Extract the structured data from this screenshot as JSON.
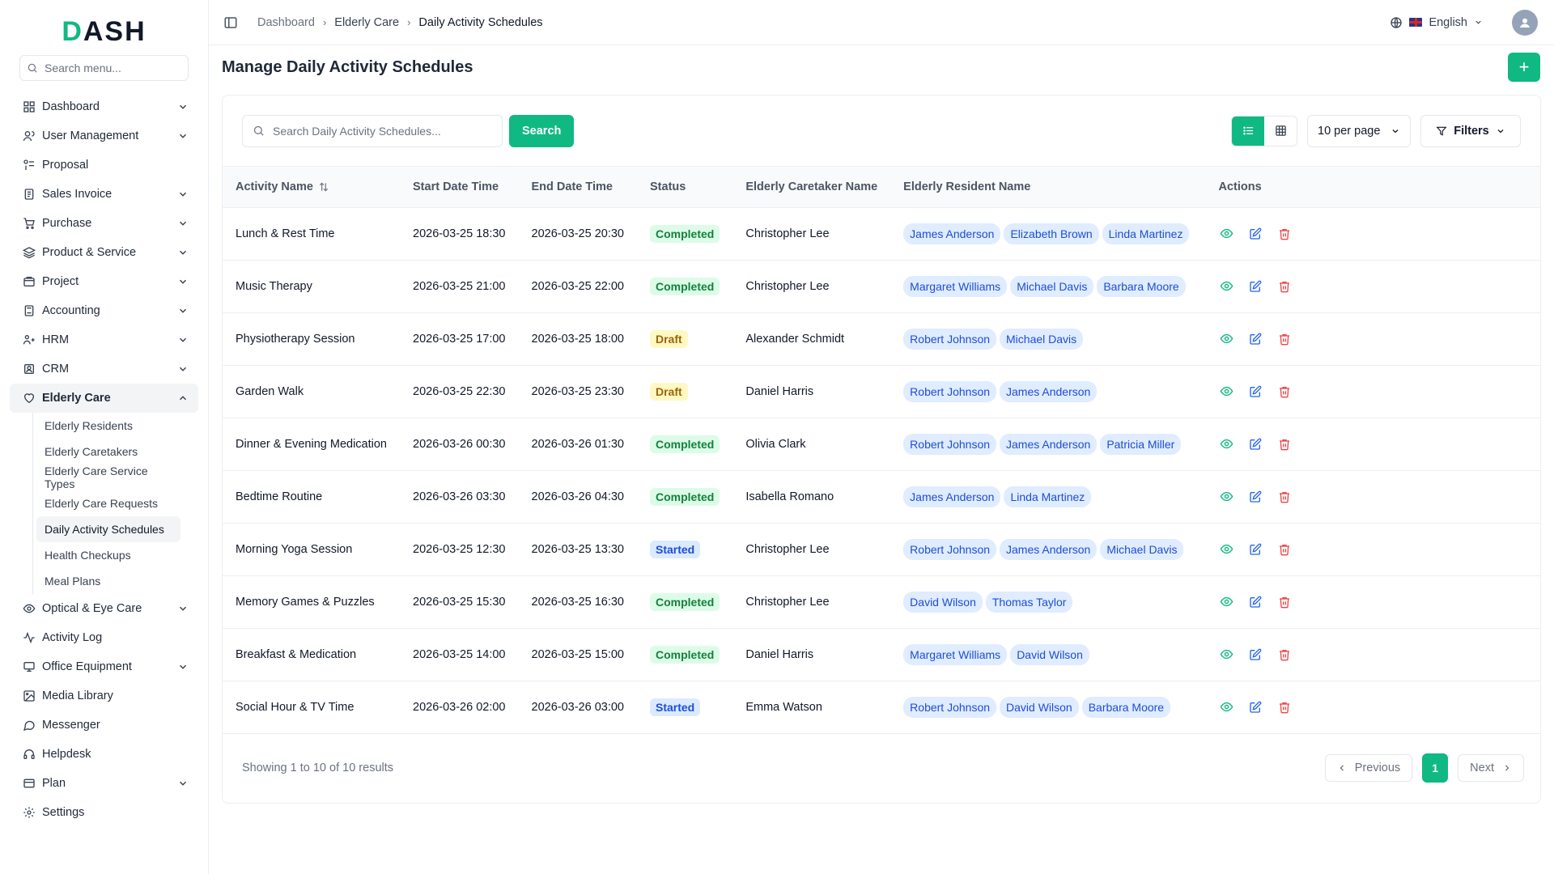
{
  "brand": {
    "logo_prefix": "D",
    "logo_rest": "ASH",
    "accent_color": "#10b981"
  },
  "sidebar": {
    "search_placeholder": "Search menu...",
    "items": [
      {
        "label": "Dashboard",
        "icon": "dashboard-icon",
        "chevron": "down"
      },
      {
        "label": "User Management",
        "icon": "users-icon",
        "chevron": "down"
      },
      {
        "label": "Proposal",
        "icon": "proposal-icon",
        "chevron": ""
      },
      {
        "label": "Sales Invoice",
        "icon": "invoice-icon",
        "chevron": "down"
      },
      {
        "label": "Purchase",
        "icon": "cart-icon",
        "chevron": "down"
      },
      {
        "label": "Product & Service",
        "icon": "layers-icon",
        "chevron": "down"
      },
      {
        "label": "Project",
        "icon": "project-icon",
        "chevron": "down"
      },
      {
        "label": "Accounting",
        "icon": "calculator-icon",
        "chevron": "down"
      },
      {
        "label": "HRM",
        "icon": "hrm-icon",
        "chevron": "down"
      },
      {
        "label": "CRM",
        "icon": "crm-icon",
        "chevron": "down"
      },
      {
        "label": "Elderly Care",
        "icon": "heart-icon",
        "chevron": "up"
      }
    ],
    "sub_items": [
      "Elderly Residents",
      "Elderly Caretakers",
      "Elderly Care Service Types",
      "Elderly Care Requests",
      "Daily Activity Schedules",
      "Health Checkups",
      "Meal Plans"
    ],
    "items_after": [
      {
        "label": "Optical & Eye Care",
        "icon": "eye-icon",
        "chevron": "down"
      },
      {
        "label": "Activity Log",
        "icon": "activity-icon",
        "chevron": ""
      },
      {
        "label": "Office Equipment",
        "icon": "monitor-icon",
        "chevron": "down"
      },
      {
        "label": "Media Library",
        "icon": "image-icon",
        "chevron": ""
      },
      {
        "label": "Messenger",
        "icon": "message-icon",
        "chevron": ""
      },
      {
        "label": "Helpdesk",
        "icon": "headset-icon",
        "chevron": ""
      },
      {
        "label": "Plan",
        "icon": "card-icon",
        "chevron": "down"
      },
      {
        "label": "Settings",
        "icon": "gear-icon",
        "chevron": ""
      }
    ]
  },
  "topbar": {
    "breadcrumbs": [
      "Dashboard",
      "Elderly Care",
      "Daily Activity Schedules"
    ],
    "language": "English"
  },
  "page": {
    "title": "Manage Daily Activity Schedules",
    "add_label": "+"
  },
  "toolbar": {
    "search_placeholder": "Search Daily Activity Schedules...",
    "search_button": "Search",
    "per_page": "10 per page",
    "filters": "Filters"
  },
  "table": {
    "columns": [
      "Activity Name",
      "Start Date Time",
      "End Date Time",
      "Status",
      "Elderly Caretaker Name",
      "Elderly Resident Name",
      "Actions"
    ],
    "rows": [
      {
        "activity": "Lunch & Rest Time",
        "start": "2026-03-25 18:30",
        "end": "2026-03-25 20:30",
        "status": "Completed",
        "caretaker": "Christopher Lee",
        "residents": [
          "James Anderson",
          "Elizabeth Brown",
          "Linda Martinez"
        ]
      },
      {
        "activity": "Music Therapy",
        "start": "2026-03-25 21:00",
        "end": "2026-03-25 22:00",
        "status": "Completed",
        "caretaker": "Christopher Lee",
        "residents": [
          "Margaret Williams",
          "Michael Davis",
          "Barbara Moore"
        ]
      },
      {
        "activity": "Physiotherapy Session",
        "start": "2026-03-25 17:00",
        "end": "2026-03-25 18:00",
        "status": "Draft",
        "caretaker": "Alexander Schmidt",
        "residents": [
          "Robert Johnson",
          "Michael Davis"
        ]
      },
      {
        "activity": "Garden Walk",
        "start": "2026-03-25 22:30",
        "end": "2026-03-25 23:30",
        "status": "Draft",
        "caretaker": "Daniel Harris",
        "residents": [
          "Robert Johnson",
          "James Anderson"
        ]
      },
      {
        "activity": "Dinner & Evening Medication",
        "start": "2026-03-26 00:30",
        "end": "2026-03-26 01:30",
        "status": "Completed",
        "caretaker": "Olivia Clark",
        "residents": [
          "Robert Johnson",
          "James Anderson",
          "Patricia Miller"
        ]
      },
      {
        "activity": "Bedtime Routine",
        "start": "2026-03-26 03:30",
        "end": "2026-03-26 04:30",
        "status": "Completed",
        "caretaker": "Isabella Romano",
        "residents": [
          "James Anderson",
          "Linda Martinez"
        ]
      },
      {
        "activity": "Morning Yoga Session",
        "start": "2026-03-25 12:30",
        "end": "2026-03-25 13:30",
        "status": "Started",
        "caretaker": "Christopher Lee",
        "residents": [
          "Robert Johnson",
          "James Anderson",
          "Michael Davis"
        ]
      },
      {
        "activity": "Memory Games & Puzzles",
        "start": "2026-03-25 15:30",
        "end": "2026-03-25 16:30",
        "status": "Completed",
        "caretaker": "Christopher Lee",
        "residents": [
          "David Wilson",
          "Thomas Taylor"
        ]
      },
      {
        "activity": "Breakfast & Medication",
        "start": "2026-03-25 14:00",
        "end": "2026-03-25 15:00",
        "status": "Completed",
        "caretaker": "Daniel Harris",
        "residents": [
          "Margaret Williams",
          "David Wilson"
        ]
      },
      {
        "activity": "Social Hour & TV Time",
        "start": "2026-03-26 02:00",
        "end": "2026-03-26 03:00",
        "status": "Started",
        "caretaker": "Emma Watson",
        "residents": [
          "Robert Johnson",
          "David Wilson",
          "Barbara Moore"
        ]
      }
    ]
  },
  "footer": {
    "showing": "Showing 1 to 10 of 10 results",
    "previous": "Previous",
    "page": "1",
    "next": "Next"
  }
}
